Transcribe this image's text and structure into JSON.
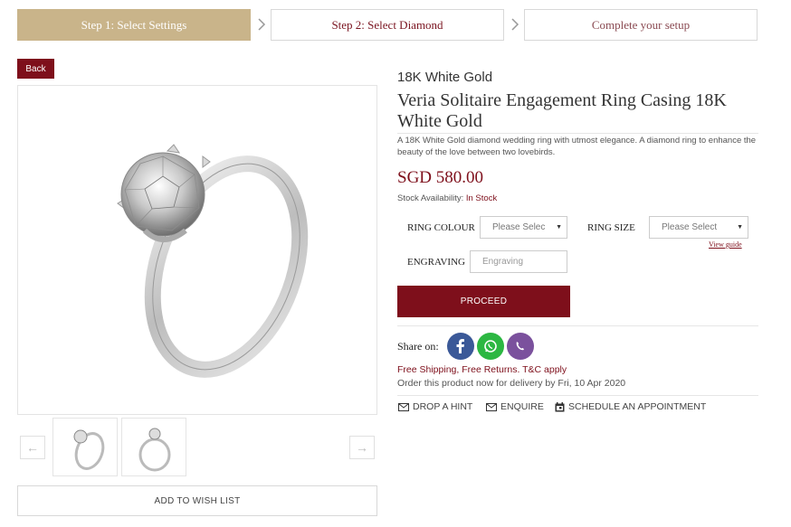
{
  "steps": {
    "step1": "Step 1: Select Settings",
    "step2": "Step 2: Select Diamond",
    "step3": "Complete your setup"
  },
  "back_label": "Back",
  "gallery": {
    "prev_icon": "arrow-left-icon",
    "next_icon": "arrow-right-icon",
    "thumbnails": [
      "ring-angle-view",
      "ring-front-view"
    ]
  },
  "wishlist_label": "ADD TO WISH LIST",
  "product": {
    "metal": "18K White Gold",
    "title": "Veria Solitaire Engagement Ring Casing 18K White Gold",
    "description": "A 18K White Gold diamond wedding ring with utmost elegance. A diamond ring to enhance the beauty of the love between two lovebirds.",
    "price": "SGD 580.00",
    "stock_label": "Stock Availability:",
    "stock_value": "In Stock"
  },
  "options": {
    "ring_colour_label": "RING COLOUR",
    "ring_colour_value": "Please Selec",
    "ring_size_label": "RING SIZE",
    "ring_size_value": "Please Select",
    "view_guide": "View guide",
    "engraving_label": "ENGRAVING",
    "engraving_placeholder": "Engraving"
  },
  "proceed_label": "PROCEED",
  "share": {
    "label": "Share on:",
    "networks": [
      "facebook",
      "whatsapp",
      "viber"
    ],
    "colors": {
      "facebook": "#3b5998",
      "whatsapp": "#2cb742",
      "viber": "#7b519d"
    }
  },
  "shipping": {
    "line1": "Free Shipping, Free Returns. T&C apply",
    "line2": "Order this product now for delivery by Fri, 10 Apr 2020"
  },
  "actions": {
    "hint": "DROP A HINT",
    "enquire": "ENQUIRE",
    "appointment": "SCHEDULE AN APPOINTMENT"
  },
  "colors": {
    "accent": "#7e0f1b",
    "gold": "#c9b48a"
  }
}
